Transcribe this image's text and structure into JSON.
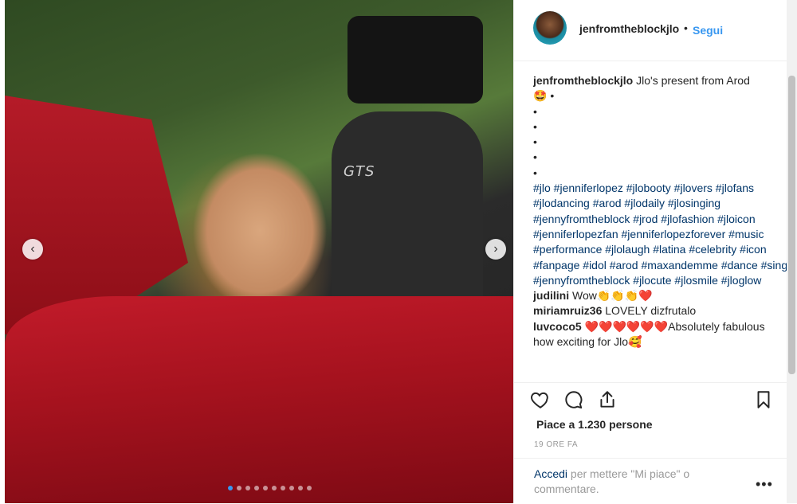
{
  "post": {
    "username": "jenfromtheblockjlo",
    "separator": "•",
    "follow_label": "Segui",
    "caption_text": "Jlo's present from Arod",
    "caption_emoji": "🤩 •",
    "bullets": [
      "•",
      "•",
      "•",
      "•",
      "•"
    ],
    "hashtags": "#jlo #jenniferlopez #jlobooty #jlovers #jlofans #jlodancing #arod #jlodaily #jlosinging #jennyfromtheblock #jrod #jlofashion #jloicon #jenniferlopezfan #jenniferlopezforever #music #performance #jlolaugh #latina #celebrity #icon #fanpage #idol #arod #maxandemme #dance #sing #jennyfromtheblock #jlocute #jlosmile #jloglow",
    "comments": [
      {
        "user": "judilini",
        "text": "Wow👏👏👏❤️"
      },
      {
        "user": "miriamruiz36",
        "text": "LOVELY dizfrutalo"
      },
      {
        "user": "luvcoco5",
        "text": "❤️❤️❤️❤️❤️❤️Absolutely fabulous how exciting for Jlo🥰"
      }
    ],
    "likes_label": "Piace a 1.230 persone",
    "time_label": "19 ORE FA",
    "login_link": "Accedi",
    "login_text": "per mettere \"Mi piace\" o commentare.",
    "more_label": "•••",
    "seat_label": "GTS",
    "nav_prev": "‹",
    "nav_next": "›",
    "slide_count": 10,
    "active_slide": 1
  },
  "icons": {
    "like": "heart-icon",
    "comment": "comment-icon",
    "share": "share-icon",
    "save": "bookmark-icon"
  },
  "colors": {
    "link_blue": "#3897f0",
    "hashtag": "#003569",
    "muted": "#999999"
  }
}
